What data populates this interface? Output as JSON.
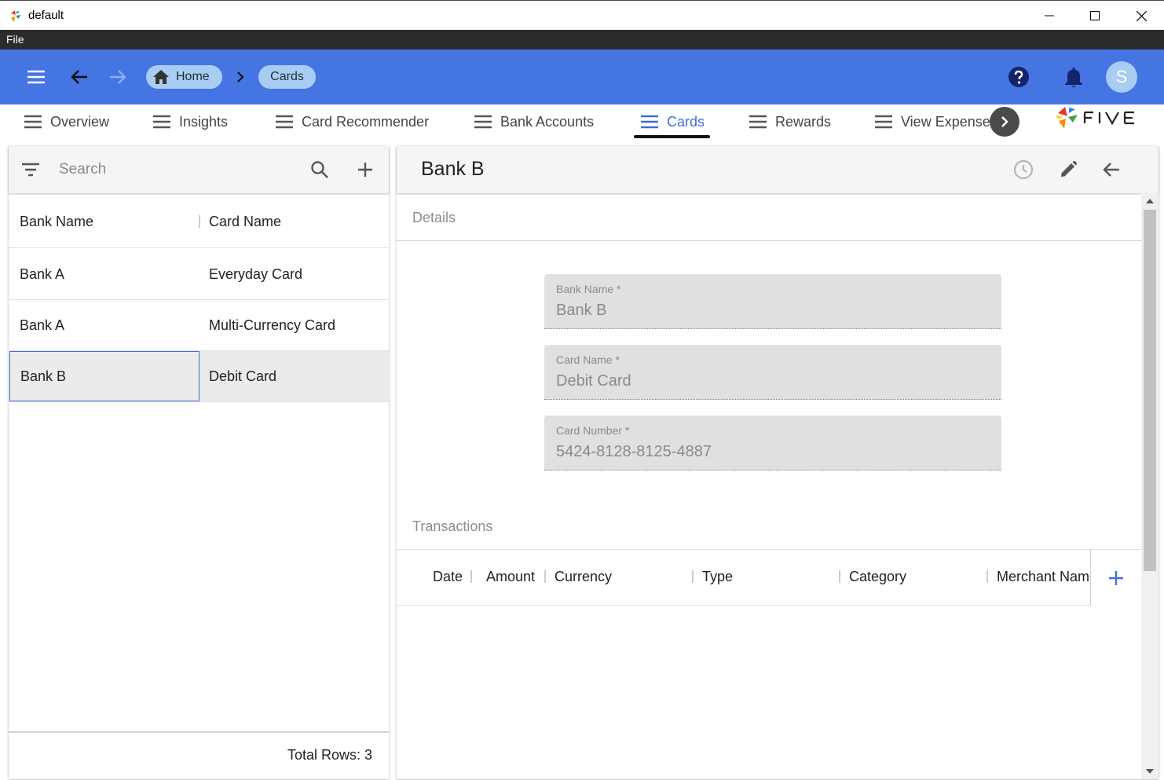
{
  "window": {
    "title": "default"
  },
  "menu": {
    "file": "File"
  },
  "appbar": {
    "breadcrumb": [
      {
        "label": "Home"
      },
      {
        "label": "Cards"
      }
    ],
    "avatar_initial": "S",
    "colors": {
      "bar": "#4475e3",
      "chip": "#a8cdf3"
    }
  },
  "tabs": [
    {
      "label": "Overview"
    },
    {
      "label": "Insights"
    },
    {
      "label": "Card Recommender"
    },
    {
      "label": "Bank Accounts"
    },
    {
      "label": "Cards",
      "active": true
    },
    {
      "label": "Rewards"
    },
    {
      "label": "View Expenses"
    }
  ],
  "list": {
    "search_placeholder": "Search",
    "columns": [
      "Bank Name",
      "Card Name"
    ],
    "rows": [
      {
        "bank": "Bank A",
        "card": "Everyday Card"
      },
      {
        "bank": "Bank A",
        "card": "Multi-Currency Card"
      },
      {
        "bank": "Bank B",
        "card": "Debit Card",
        "selected": true
      }
    ],
    "total_rows": "Total Rows: 3"
  },
  "detail": {
    "title": "Bank B",
    "details_label": "Details",
    "fields": [
      {
        "label": "Bank Name *",
        "value": "Bank B"
      },
      {
        "label": "Card Name *",
        "value": "Debit Card"
      },
      {
        "label": "Card Number *",
        "value": "5424-8128-8125-4887"
      }
    ],
    "transactions_label": "Transactions",
    "transaction_columns": [
      "Date",
      "Amount",
      "Currency",
      "Type",
      "Category",
      "Merchant Name"
    ]
  }
}
